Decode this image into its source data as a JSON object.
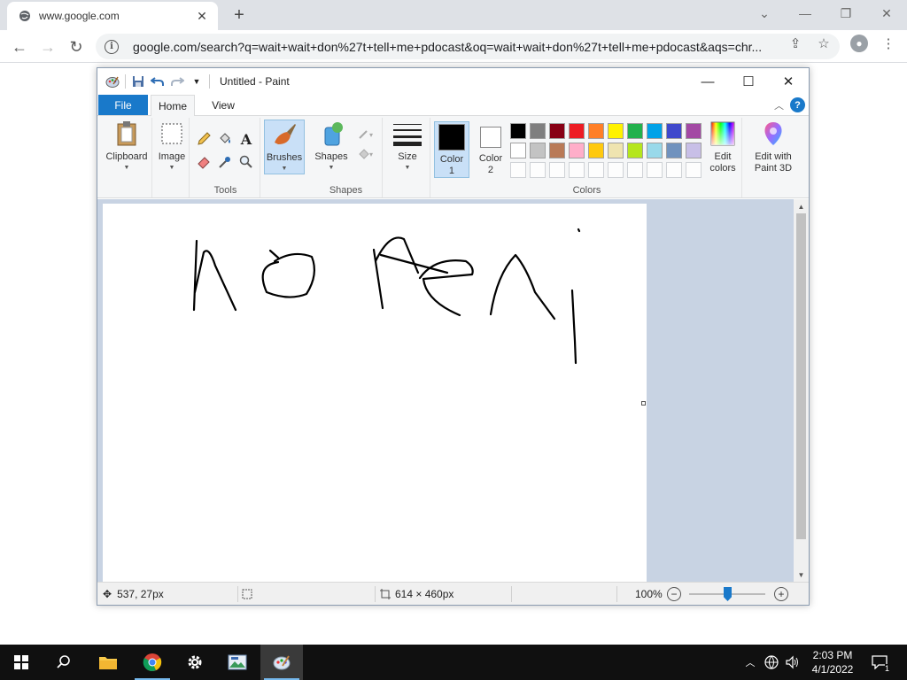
{
  "browser": {
    "tab_title": "www.google.com",
    "url": "google.com/search?q=wait+wait+don%27t+tell+me+pdocast&oq=wait+wait+don%27t+tell+me+pdocast&aqs=chr..."
  },
  "paint": {
    "window_title": "Untitled - Paint",
    "tabs": {
      "file": "File",
      "home": "Home",
      "view": "View"
    },
    "ribbon": {
      "clipboard": "Clipboard",
      "image": "Image",
      "tools_group": "Tools",
      "brushes": "Brushes",
      "shapes": "Shapes",
      "shapes_group": "Shapes",
      "size": "Size",
      "color1": "Color\n1",
      "color1_line1": "Color",
      "color1_line2": "1",
      "color2_line1": "Color",
      "color2_line2": "2",
      "colors_group": "Colors",
      "edit_colors_line1": "Edit",
      "edit_colors_line2": "colors",
      "paint3d_line1": "Edit with",
      "paint3d_line2": "Paint 3D"
    },
    "palette_row1": [
      "#000000",
      "#7f7f7f",
      "#880015",
      "#ed1c24",
      "#ff7f27",
      "#fff200",
      "#22b14c",
      "#00a2e8",
      "#3f48cc",
      "#a349a4"
    ],
    "palette_row2": [
      "#ffffff",
      "#c3c3c3",
      "#b97a57",
      "#ffaec9",
      "#ffc90e",
      "#efe4b0",
      "#b5e61d",
      "#99d9ea",
      "#7092be",
      "#c8bfe7"
    ],
    "color1_value": "#000000",
    "color2_value": "#ffffff",
    "status": {
      "cursor_pos": "537, 27px",
      "image_size": "614 × 460px",
      "zoom": "100%"
    }
  },
  "taskbar": {
    "time": "2:03 PM",
    "date": "4/1/2022",
    "notification_count": "1"
  }
}
